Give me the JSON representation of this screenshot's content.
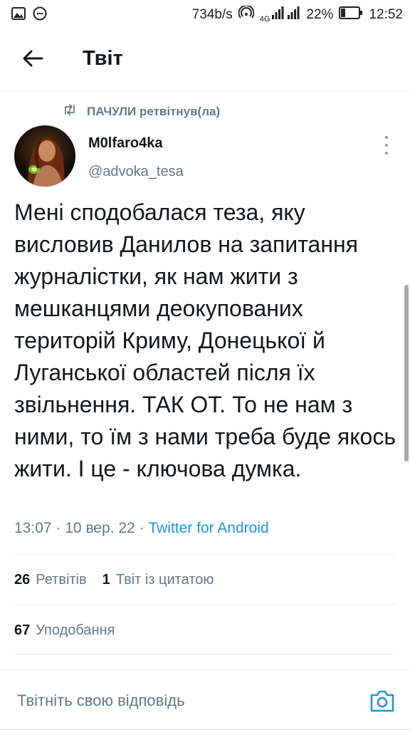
{
  "status_bar": {
    "speed": "734b/s",
    "network": "4G",
    "battery": "22%",
    "time": "12:52"
  },
  "header": {
    "title": "Твіт"
  },
  "retweet": {
    "text": "ПАЧУЛИ ретвітнув(ла)"
  },
  "author": {
    "name": "M0lfaro4ka",
    "handle": "@advoka_tesa"
  },
  "tweet": {
    "text": "Мені сподобалася теза, яку висловив Данилов на запитання журналістки, як нам жити з мешканцями деокупованих територій Криму, Донецької й Луганської областей після їх звільнення. ТАК ОТ. То не нам з ними, то їм з нами треба буде якось жити. І це - ключова думка."
  },
  "meta": {
    "time": "13:07",
    "date": "10 вер. 22",
    "separator": "·",
    "source": "Twitter for Android"
  },
  "stats": {
    "retweets_count": "26",
    "retweets_label": "Ретвітів",
    "quotes_count": "1",
    "quotes_label": "Твіт із цитатою",
    "likes_count": "67",
    "likes_label": "Уподобання"
  },
  "reply": {
    "placeholder": "Твітніть свою відповідь"
  },
  "colors": {
    "accent": "#1b95e0",
    "secondary_text": "#657786",
    "divider": "#e6ecf0"
  },
  "icons": [
    "gallery-icon",
    "smile-icon",
    "wifi-hotspot-icon",
    "signal-icon",
    "battery-icon",
    "back-arrow-icon",
    "retweet-icon",
    "more-icon",
    "camera-icon"
  ]
}
